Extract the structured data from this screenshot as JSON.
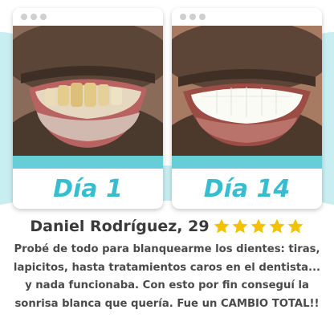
{
  "colors": {
    "accent": "#36bdd0",
    "strip": "#67cdd8",
    "wave": "#c8eef1",
    "star": "#f2c200",
    "text": "#3a3a3a"
  },
  "cards": [
    {
      "day_label": "Día 1",
      "photo": "smile-before-yellow-teeth"
    },
    {
      "day_label": "Día 14",
      "photo": "smile-after-white-teeth"
    }
  ],
  "review": {
    "reviewer": "Daniel Rodríguez, 29",
    "rating": 5,
    "lines": [
      "Probé de todo para blanquearme los dientes: tiras,",
      "lapicitos, hasta tratamientos caros en el dentista...",
      "y nada funcionaba. Con esto por fin conseguí la",
      "sonrisa blanca que quería. Fue un CAMBIO TOTAL!!"
    ]
  }
}
